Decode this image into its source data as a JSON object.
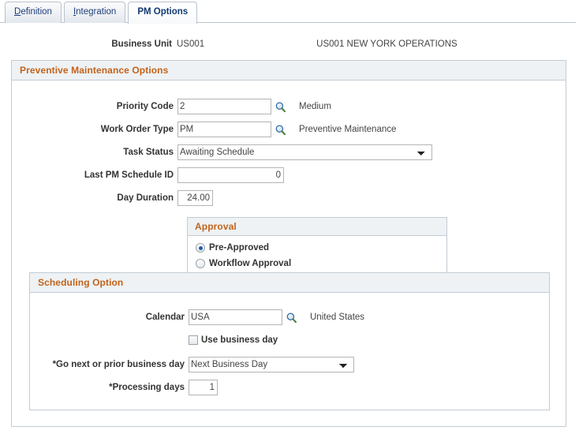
{
  "tabs": [
    {
      "name": "tab-definition",
      "accel": "D",
      "rest": "efinition",
      "active": false
    },
    {
      "name": "tab-integration",
      "accel": "I",
      "rest": "ntegration",
      "active": false
    },
    {
      "name": "tab-pm-options",
      "accel": "",
      "rest": "PM Options",
      "active": true
    }
  ],
  "header": {
    "business_unit_label": "Business Unit",
    "business_unit_value": "US001",
    "business_unit_desc": "US001 NEW YORK OPERATIONS"
  },
  "pm_options": {
    "group_title": "Preventive Maintenance Options",
    "priority_code": {
      "label": "Priority Code",
      "value": "2",
      "desc": "Medium",
      "lookup_icon": "magnifier-icon"
    },
    "work_order_type": {
      "label": "Work Order Type",
      "value": "PM",
      "desc": "Preventive Maintenance",
      "lookup_icon": "magnifier-icon"
    },
    "task_status": {
      "label": "Task Status",
      "value": "Awaiting Schedule",
      "options": [
        "Awaiting Schedule"
      ]
    },
    "last_pm_schedule_id": {
      "label": "Last PM Schedule ID",
      "value": "0"
    },
    "day_duration": {
      "label": "Day Duration",
      "value": "24.00"
    }
  },
  "approval": {
    "group_title": "Approval",
    "options": [
      {
        "label": "Pre-Approved",
        "selected": true
      },
      {
        "label": "Workflow Approval",
        "selected": false
      }
    ]
  },
  "scheduling": {
    "group_title": "Scheduling Option",
    "calendar": {
      "label": "Calendar",
      "value": "USA",
      "desc": "United States",
      "lookup_icon": "magnifier-icon"
    },
    "use_business_day": {
      "label": "Use business day",
      "checked": false
    },
    "go_next_or_prior": {
      "label": "*Go next or prior business day",
      "value": "Next Business Day",
      "options": [
        "Next Business Day"
      ]
    },
    "processing_days": {
      "label": "*Processing days",
      "value": "1"
    }
  },
  "colors": {
    "group_header_text": "#c2631c",
    "group_header_bg": "#eef2f4",
    "tab_text": "#1f3f7a",
    "border": "#c3cbd4",
    "radio_dot": "#1d5fa8"
  }
}
